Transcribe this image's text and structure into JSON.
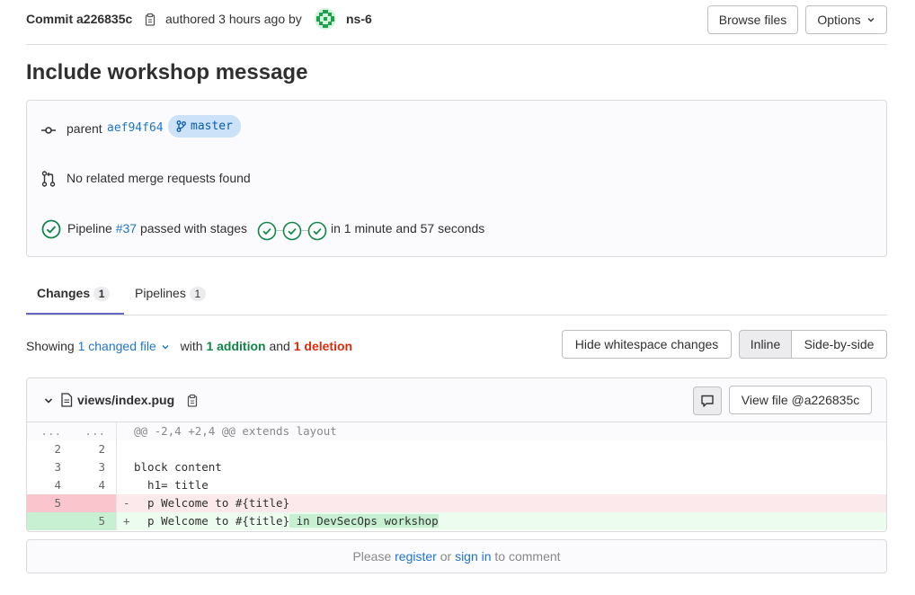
{
  "header": {
    "commit_label": "Commit a226835c",
    "authored_text": "authored 3 hours ago by",
    "author_name": "ns-6",
    "browse_files_label": "Browse files",
    "options_label": "Options"
  },
  "commit": {
    "title": "Include workshop message",
    "parent_label": "parent",
    "parent_sha": "aef94f64",
    "branch": "master",
    "merge_requests_text": "No related merge requests found",
    "pipeline_label": "Pipeline",
    "pipeline_id": "#37",
    "pipeline_status_text": "passed with stages",
    "pipeline_duration_text": "in 1 minute and 57 seconds",
    "stage_count": 3
  },
  "tabs": [
    {
      "label": "Changes",
      "count": "1",
      "active": true
    },
    {
      "label": "Pipelines",
      "count": "1",
      "active": false
    }
  ],
  "diff_summary": {
    "showing_label": "Showing",
    "changed_files": "1 changed file",
    "with_label": "with",
    "additions": "1 addition",
    "and_label": "and",
    "deletions": "1 deletion",
    "hide_whitespace_label": "Hide whitespace changes",
    "inline_label": "Inline",
    "side_by_side_label": "Side-by-side",
    "view_mode": "inline"
  },
  "file": {
    "path": "views/index.pug",
    "view_file_label": "View file @a226835c",
    "lines": [
      {
        "type": "match",
        "old": "...",
        "new": "...",
        "sign": "",
        "text": "@@ -2,4 +2,4 @@ extends layout"
      },
      {
        "type": "context",
        "old": "2",
        "new": "2",
        "sign": "",
        "text": ""
      },
      {
        "type": "context",
        "old": "3",
        "new": "3",
        "sign": "",
        "text": "block content"
      },
      {
        "type": "context",
        "old": "4",
        "new": "4",
        "sign": "",
        "text": "  h1= title"
      },
      {
        "type": "old",
        "old": "5",
        "new": "",
        "sign": "-",
        "text": "  p Welcome to #{title}"
      },
      {
        "type": "new",
        "old": "",
        "new": "5",
        "sign": "+",
        "text": "  p Welcome to #{title}",
        "highlight": " in DevSecOps workshop"
      }
    ]
  },
  "comment": {
    "please": "Please",
    "register": "register",
    "or": "or",
    "sign_in": "sign in",
    "to_comment": "to comment"
  },
  "colors": {
    "link": "#1f75cb",
    "success": "#108548",
    "danger": "#dd2b0e",
    "removed_bg": "#fbe9eb",
    "removed_gutter": "#fac5cd",
    "added_bg": "#ecfdf0",
    "added_gutter": "#c7f0d2",
    "added_highlight": "#c7f0d2",
    "tab_active": "#6666c4"
  }
}
